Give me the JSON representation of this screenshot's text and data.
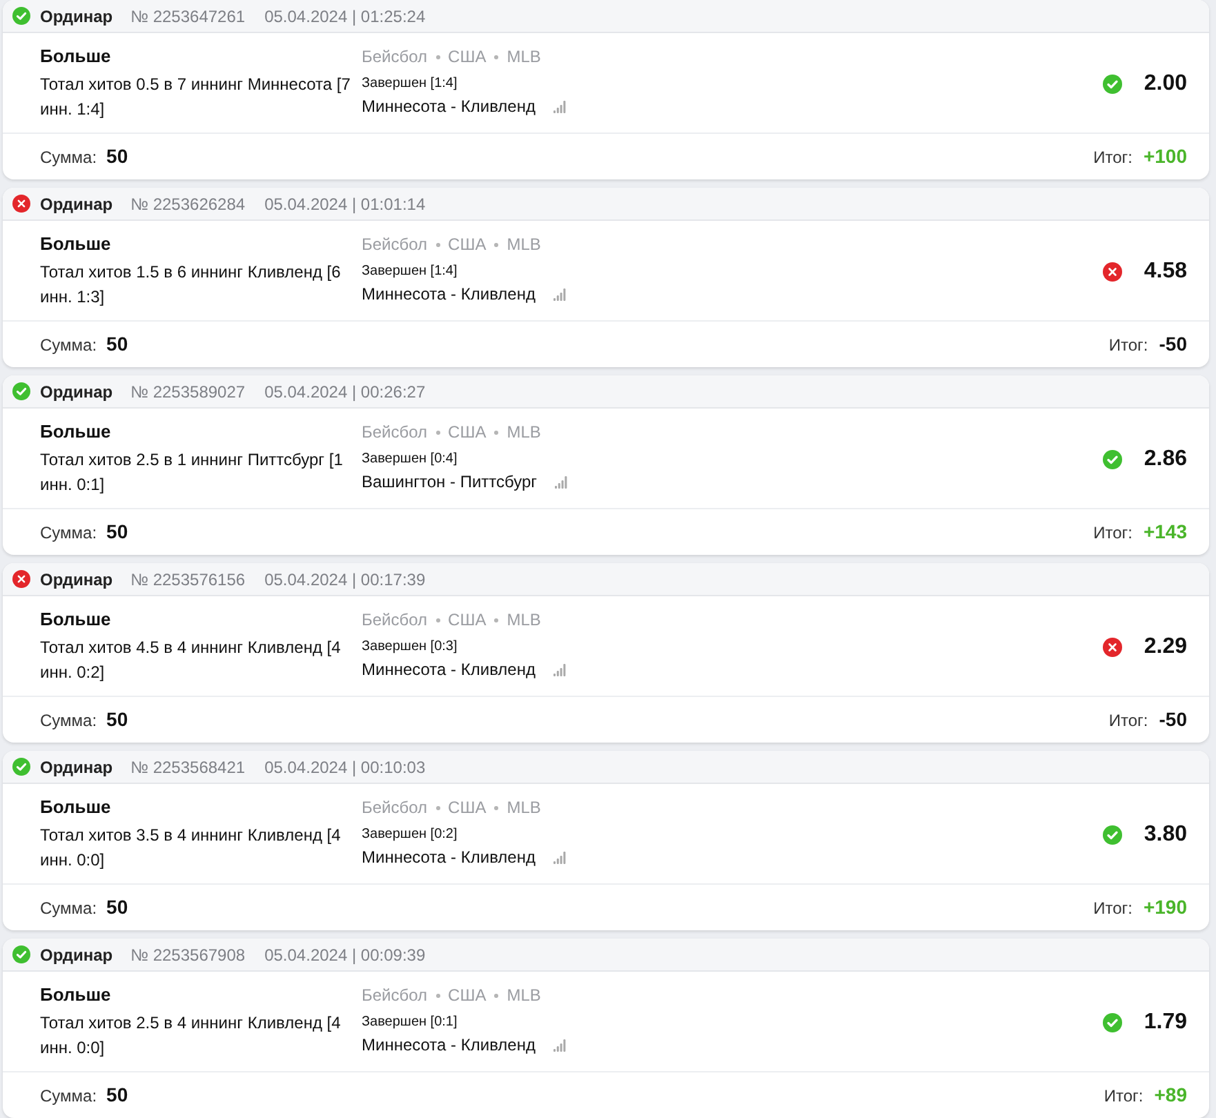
{
  "bets": [
    {
      "won": true,
      "type": "Ординар",
      "number": "№ 2253647261",
      "datetime": "05.04.2024 | 01:25:24",
      "selection": "Больше",
      "market": "Тотал хитов 0.5 в 7 иннинг Миннесота [7 инн. 1:4]",
      "sport": "Бейсбол",
      "country": "США",
      "league": "MLB",
      "match_status": "Завершен [1:4]",
      "match": "Миннесота - Кливленд",
      "odds": "2.00",
      "stake_label": "Сумма:",
      "stake": "50",
      "result_label": "Итог:",
      "result": "+100"
    },
    {
      "won": false,
      "type": "Ординар",
      "number": "№ 2253626284",
      "datetime": "05.04.2024 | 01:01:14",
      "selection": "Больше",
      "market": "Тотал хитов 1.5 в 6 иннинг Кливленд [6 инн. 1:3]",
      "sport": "Бейсбол",
      "country": "США",
      "league": "MLB",
      "match_status": "Завершен [1:4]",
      "match": "Миннесота - Кливленд",
      "odds": "4.58",
      "stake_label": "Сумма:",
      "stake": "50",
      "result_label": "Итог:",
      "result": "-50"
    },
    {
      "won": true,
      "type": "Ординар",
      "number": "№ 2253589027",
      "datetime": "05.04.2024 | 00:26:27",
      "selection": "Больше",
      "market": "Тотал хитов 2.5 в 1 иннинг Питтсбург [1 инн. 0:1]",
      "sport": "Бейсбол",
      "country": "США",
      "league": "MLB",
      "match_status": "Завершен [0:4]",
      "match": "Вашингтон - Питтсбург",
      "odds": "2.86",
      "stake_label": "Сумма:",
      "stake": "50",
      "result_label": "Итог:",
      "result": "+143"
    },
    {
      "won": false,
      "type": "Ординар",
      "number": "№ 2253576156",
      "datetime": "05.04.2024 | 00:17:39",
      "selection": "Больше",
      "market": "Тотал хитов 4.5 в 4 иннинг Кливленд [4 инн. 0:2]",
      "sport": "Бейсбол",
      "country": "США",
      "league": "MLB",
      "match_status": "Завершен [0:3]",
      "match": "Миннесота - Кливленд",
      "odds": "2.29",
      "stake_label": "Сумма:",
      "stake": "50",
      "result_label": "Итог:",
      "result": "-50"
    },
    {
      "won": true,
      "type": "Ординар",
      "number": "№ 2253568421",
      "datetime": "05.04.2024 | 00:10:03",
      "selection": "Больше",
      "market": "Тотал хитов 3.5 в 4 иннинг Кливленд [4 инн. 0:0]",
      "sport": "Бейсбол",
      "country": "США",
      "league": "MLB",
      "match_status": "Завершен [0:2]",
      "match": "Миннесота - Кливленд",
      "odds": "3.80",
      "stake_label": "Сумма:",
      "stake": "50",
      "result_label": "Итог:",
      "result": "+190"
    },
    {
      "won": true,
      "type": "Ординар",
      "number": "№ 2253567908",
      "datetime": "05.04.2024 | 00:09:39",
      "selection": "Больше",
      "market": "Тотал хитов 2.5 в 4 иннинг Кливленд [4 инн. 0:0]",
      "sport": "Бейсбол",
      "country": "США",
      "league": "MLB",
      "match_status": "Завершен [0:1]",
      "match": "Миннесота - Кливленд",
      "odds": "1.79",
      "stake_label": "Сумма:",
      "stake": "50",
      "result_label": "Итог:",
      "result": "+89"
    }
  ]
}
